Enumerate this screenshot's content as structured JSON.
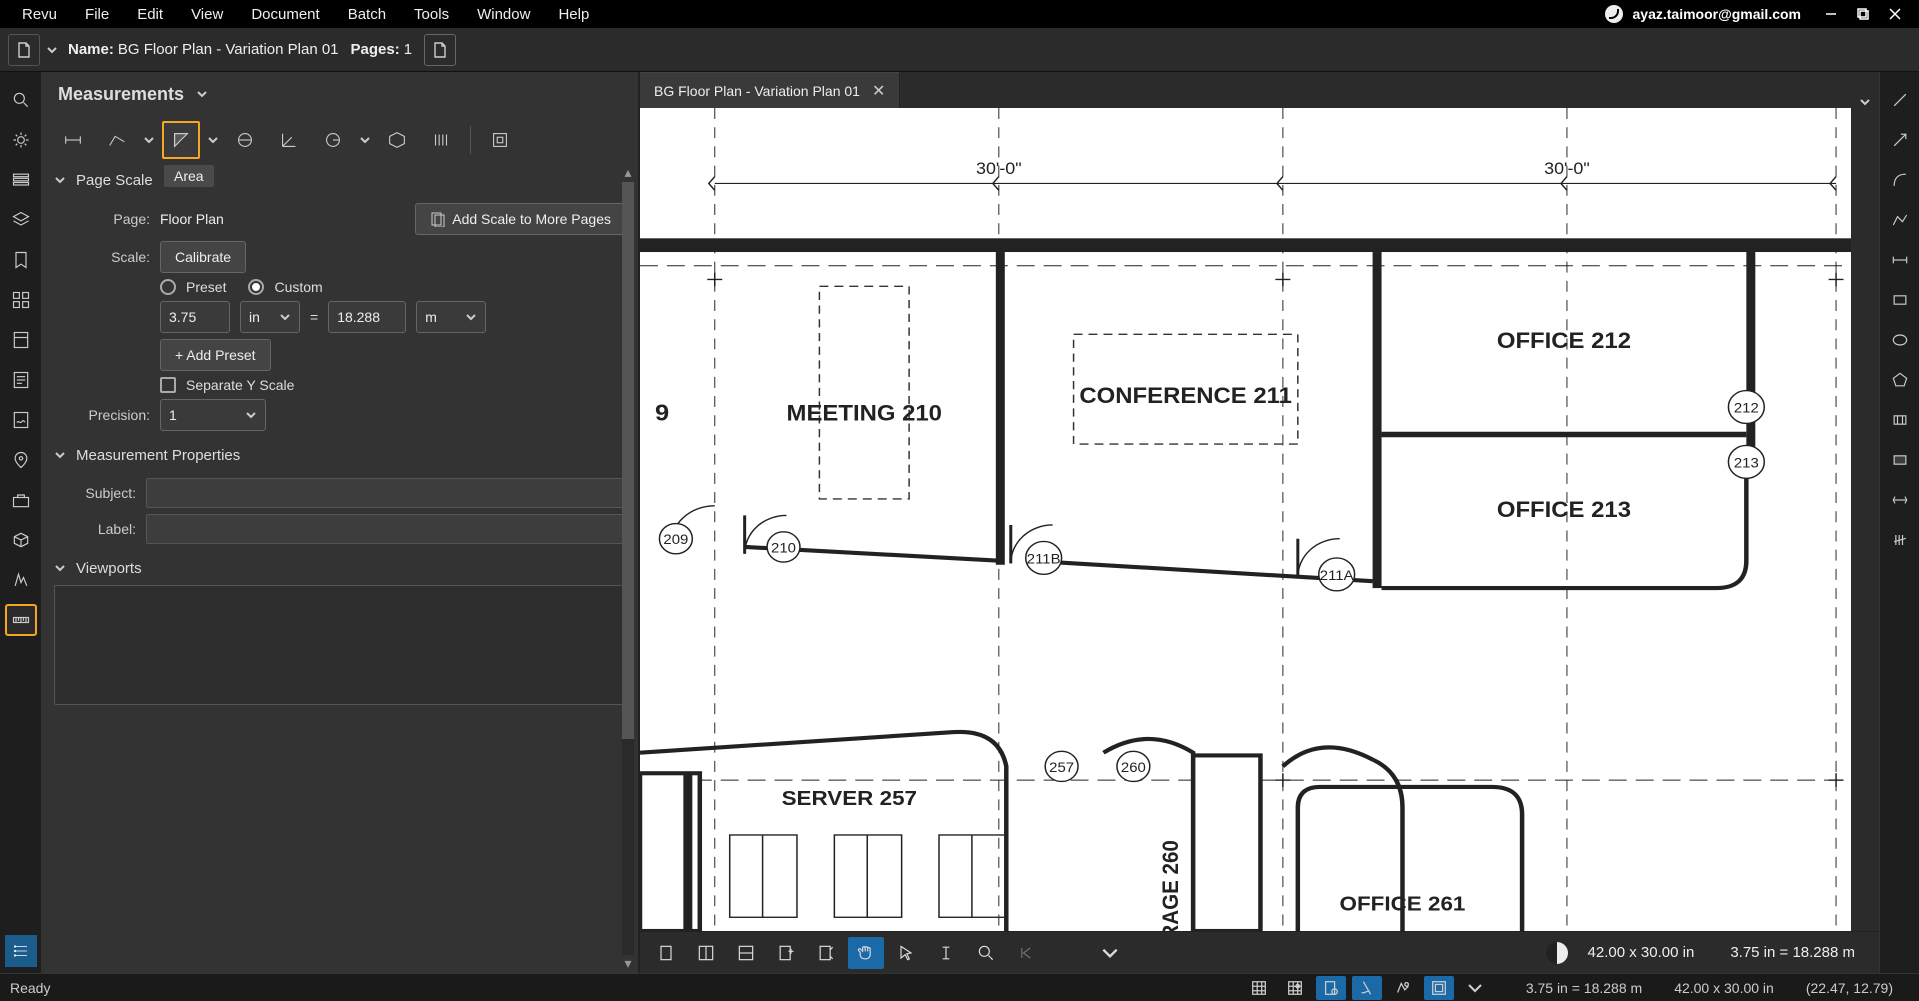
{
  "menu": [
    "Revu",
    "File",
    "Edit",
    "View",
    "Document",
    "Batch",
    "Tools",
    "Window",
    "Help"
  ],
  "user_email": "ayaz.taimoor@gmail.com",
  "docbar": {
    "name_label": "Name:",
    "name_value": "BG Floor Plan - Variation Plan 01",
    "pages_label": "Pages:",
    "pages_value": "1"
  },
  "panel": {
    "title": "Measurements",
    "tooltip_area": "Area",
    "page_scale": {
      "section": "Page Scale",
      "page_label": "Page:",
      "page_value": "Floor Plan",
      "add_scale_btn": "Add Scale to More Pages",
      "scale_label": "Scale:",
      "calibrate_btn": "Calibrate",
      "preset_label": "Preset",
      "custom_label": "Custom",
      "scale_in_value": "3.75",
      "scale_in_unit": "in",
      "equals": "=",
      "scale_out_value": "18.288",
      "scale_out_unit": "m",
      "add_preset_btn": "+ Add Preset",
      "separate_y_label": "Separate Y Scale",
      "precision_label": "Precision:",
      "precision_value": "1"
    },
    "measurement_props": {
      "section": "Measurement Properties",
      "subject_label": "Subject:",
      "label_label": "Label:"
    },
    "viewports": {
      "section": "Viewports"
    }
  },
  "tab": {
    "title": "BG Floor Plan - Variation Plan 01"
  },
  "floorplan": {
    "dim_left": "30'-0\"",
    "dim_right": "30'-0\"",
    "rooms": {
      "meeting": "MEETING  210",
      "conference": "CONFERENCE  211",
      "office212": "OFFICE  212",
      "office213": "OFFICE  213",
      "server": "SERVER  257",
      "storage": "RAGE  260",
      "office261": "OFFICE  261",
      "partial9": "9"
    },
    "doors": {
      "d209": "209",
      "d210": "210",
      "d211A": "211A",
      "d211B": "211B",
      "d212": "212",
      "d213": "213",
      "d257": "257",
      "d260": "260"
    }
  },
  "viewctrl": {
    "size_text": "42.00 x 30.00 in",
    "scale_text": "3.75 in = 18.288 m"
  },
  "statusbar": {
    "ready": "Ready",
    "scale": "3.75 in = 18.288 m",
    "size": "42.00 x 30.00 in",
    "coords": "(22.47, 12.79)"
  }
}
